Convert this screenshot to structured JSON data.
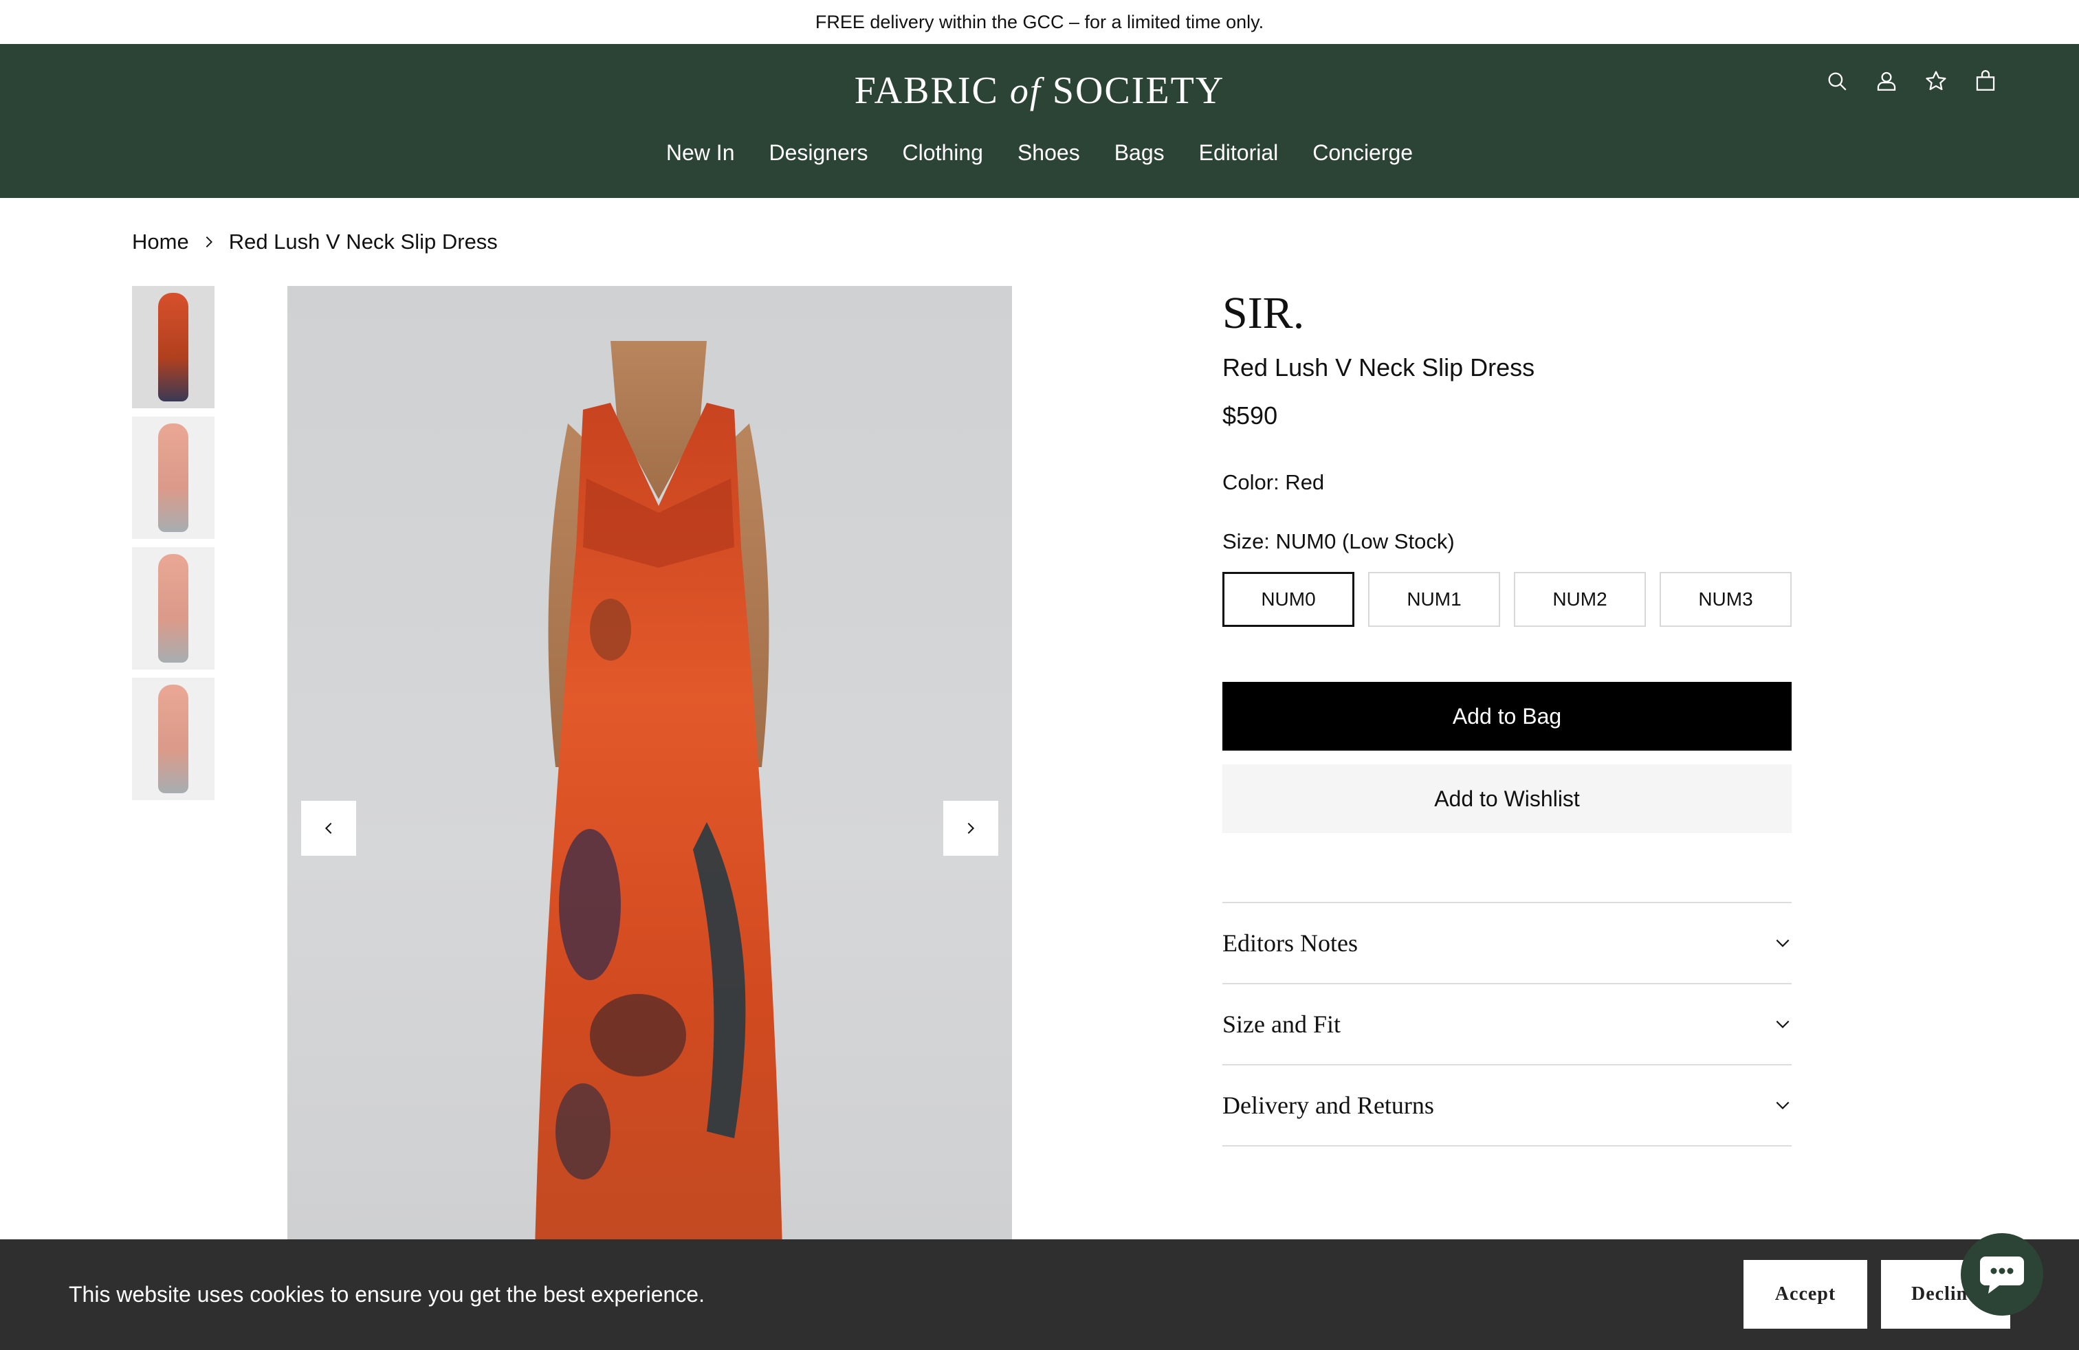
{
  "announcement": "FREE delivery within the GCC – for a limited time only.",
  "header": {
    "logo_left": "FABRIC",
    "logo_of": "of",
    "logo_right": "SOCIETY",
    "nav": [
      "New In",
      "Designers",
      "Clothing",
      "Shoes",
      "Bags",
      "Editorial",
      "Concierge"
    ],
    "icons": [
      "search-icon",
      "account-icon",
      "wishlist-star-icon",
      "bag-icon"
    ],
    "background_color": "#2c4435"
  },
  "breadcrumb": {
    "home": "Home",
    "current": "Red Lush V Neck Slip Dress"
  },
  "gallery": {
    "thumbnail_count": 4,
    "active_thumbnail": 1
  },
  "product": {
    "brand": "SIR.",
    "name": "Red Lush V Neck Slip Dress",
    "price": "$590",
    "color_label": "Color: Red",
    "size_label": "Size: NUM0 (Low Stock)",
    "sizes": [
      "NUM0",
      "NUM1",
      "NUM2",
      "NUM3"
    ],
    "selected_size": "NUM0",
    "add_to_bag": "Add to Bag",
    "add_to_wishlist": "Add to Wishlist"
  },
  "accordion": [
    "Editors Notes",
    "Size and Fit",
    "Delivery and Returns"
  ],
  "cookie": {
    "message": "This website uses cookies to ensure you get the best experience.",
    "accept": "Accept",
    "decline": "Decline"
  },
  "chat": {
    "icon": "chat-bubble-icon"
  }
}
